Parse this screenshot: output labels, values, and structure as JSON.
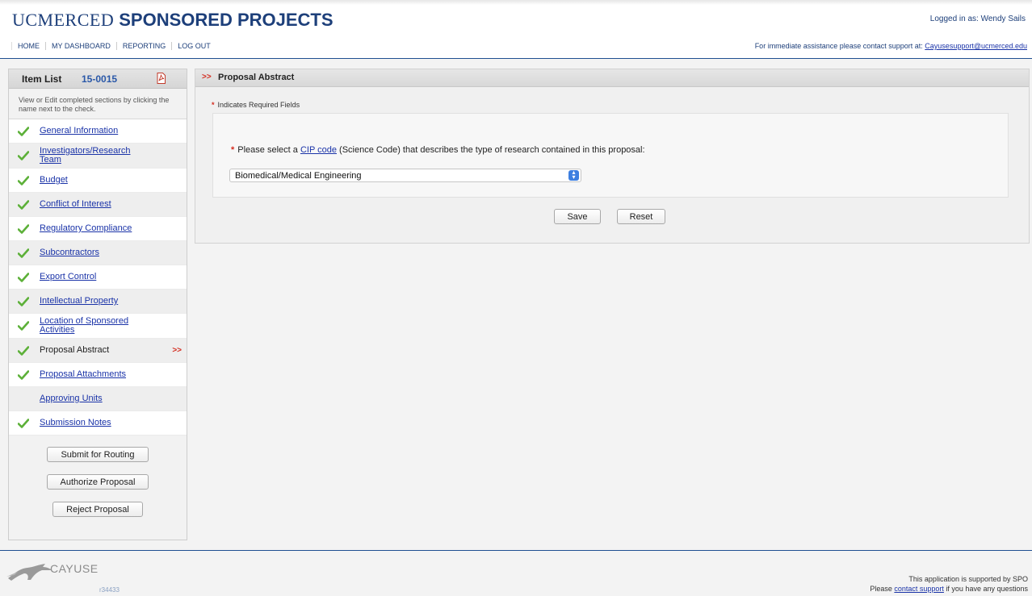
{
  "header": {
    "brand_uc": "UCMERCED",
    "brand_title": "SPONSORED PROJECTS",
    "logged_in": "Logged in as: Wendy Sails",
    "nav": [
      "HOME",
      "MY DASHBOARD",
      "REPORTING",
      "LOG OUT"
    ],
    "assist_text": "For immediate assistance please contact support at: ",
    "assist_email": "Cayusesupport@ucmerced.edu"
  },
  "sidebar": {
    "title": "Item List",
    "number": "15-0015",
    "description": "View or Edit completed sections by clicking the name next to the check.",
    "items": [
      {
        "label": "General Information",
        "checked": true
      },
      {
        "label": "Investigators/Research Team",
        "checked": true
      },
      {
        "label": "Budget",
        "checked": true
      },
      {
        "label": "Conflict of Interest",
        "checked": true
      },
      {
        "label": "Regulatory Compliance",
        "checked": true
      },
      {
        "label": "Subcontractors",
        "checked": true
      },
      {
        "label": "Export Control",
        "checked": true
      },
      {
        "label": "Intellectual Property",
        "checked": true
      },
      {
        "label": "Location of Sponsored Activities",
        "checked": true
      },
      {
        "label": "Proposal Abstract",
        "checked": true,
        "current": true
      },
      {
        "label": "Proposal Attachments",
        "checked": true
      },
      {
        "label": "Approving Units",
        "checked": false
      },
      {
        "label": "Submission Notes",
        "checked": true
      }
    ],
    "current_marker": ">>",
    "actions": {
      "submit": "Submit for Routing",
      "authorize": "Authorize Proposal",
      "reject": "Reject Proposal"
    }
  },
  "main": {
    "marker": ">>",
    "title": "Proposal Abstract",
    "required_star": "*",
    "required_note": "Indicates Required Fields",
    "question_before": "Please select a ",
    "question_link": "CIP code",
    "question_after": " (Science Code) that describes the type of research contained in this proposal:",
    "cip_selected": "Biomedical/Medical Engineering",
    "save_label": "Save",
    "reset_label": "Reset"
  },
  "footer": {
    "logo_name": "CAYUSE",
    "revision": "r34433",
    "support_line1": "This application is supported by SPO",
    "support_before": "Please ",
    "support_link": "contact support",
    "support_after": " if you have any questions"
  },
  "colors": {
    "brand_blue": "#1d3f7a",
    "link_blue": "#1a33a8",
    "marker_red": "#d42b1e",
    "check_green": "#5cb038"
  }
}
